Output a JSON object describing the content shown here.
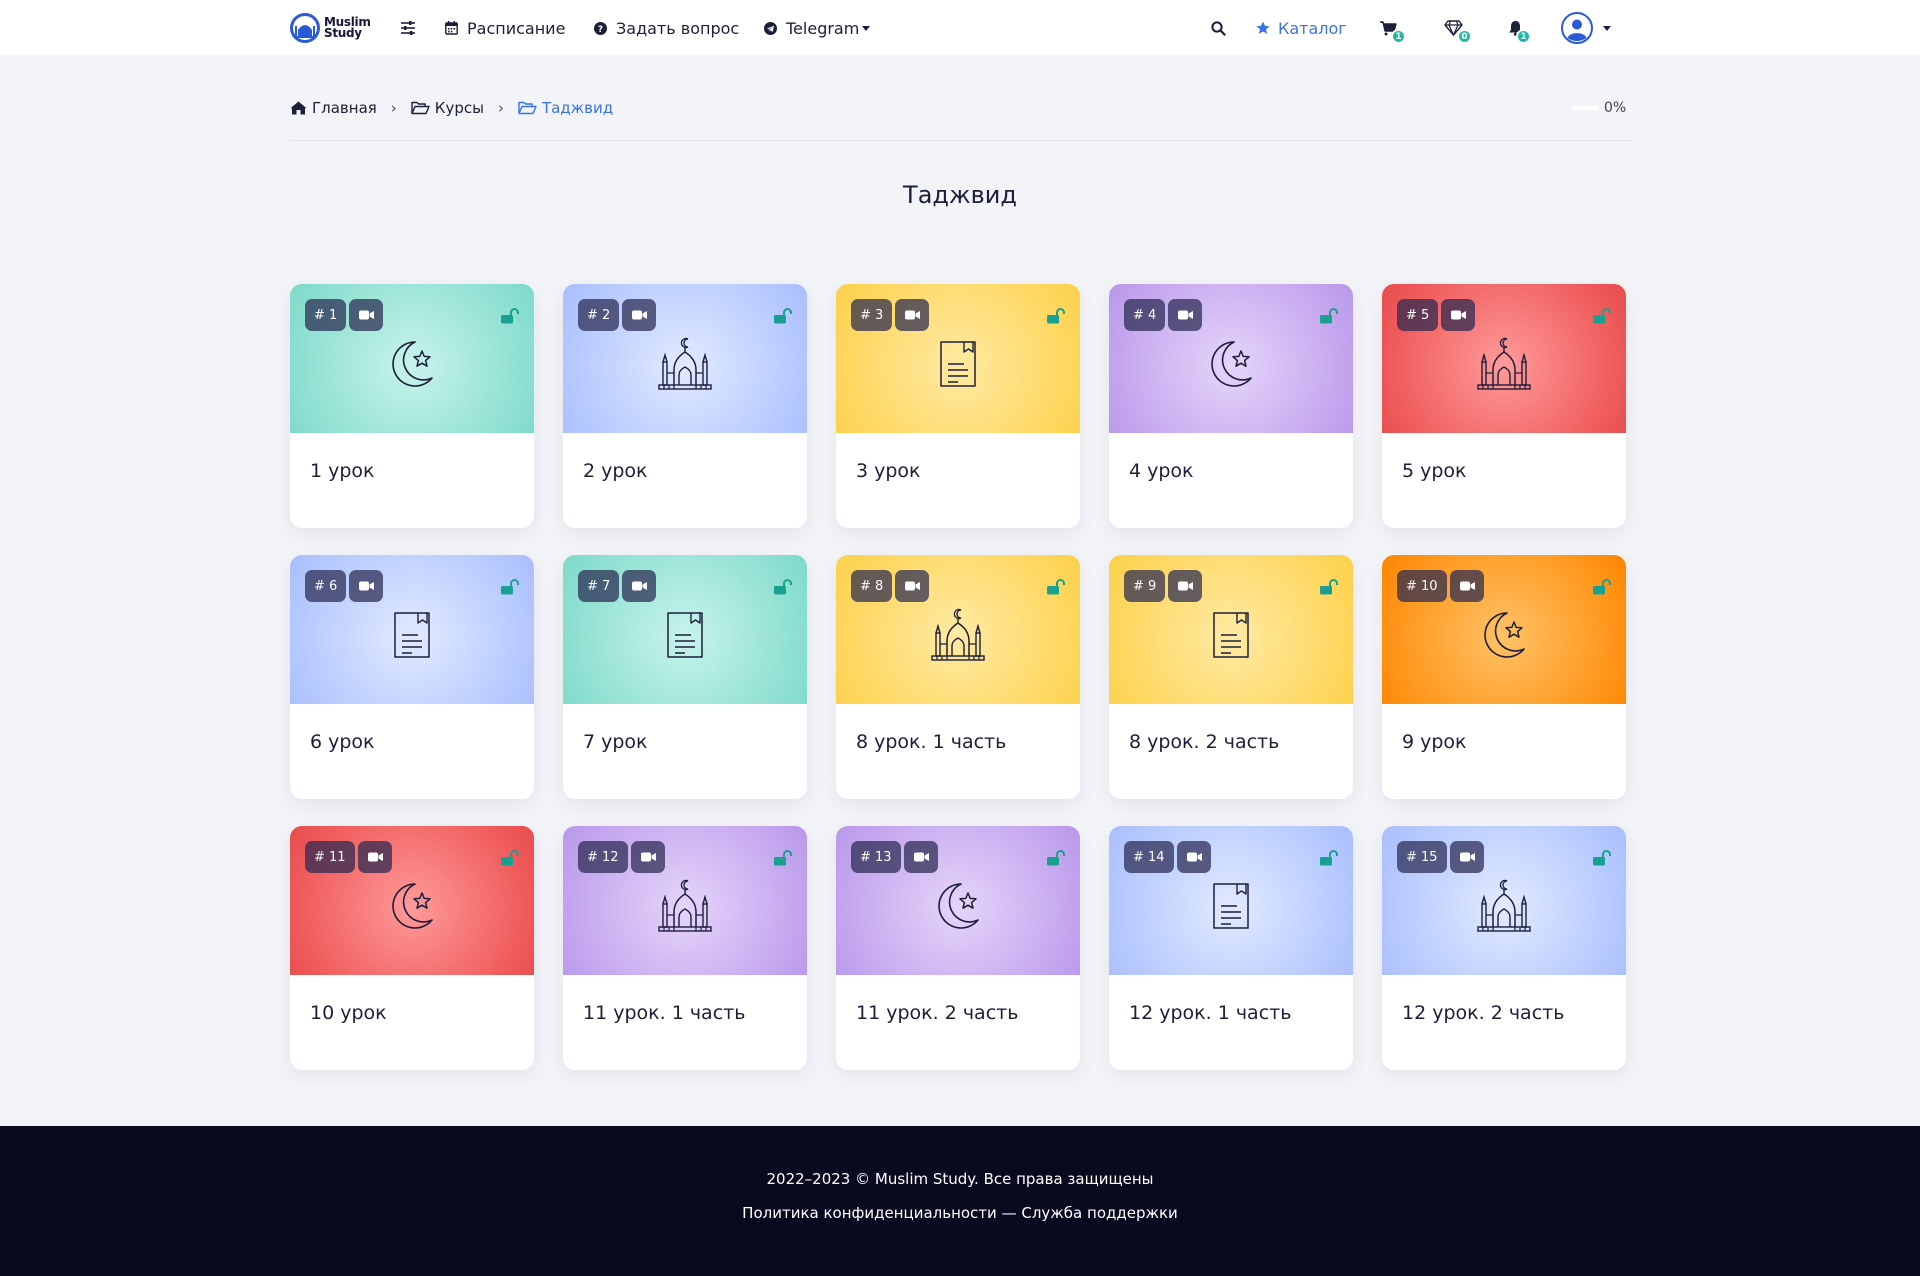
{
  "header": {
    "logo_line1": "Muslim",
    "logo_line2": "Study",
    "nav": {
      "schedule": "Расписание",
      "ask": "Задать вопрос",
      "telegram": "Telegram"
    },
    "catalog": "Каталог",
    "badges": {
      "cart": "1",
      "gems": "0",
      "bell": "1"
    }
  },
  "breadcrumb": {
    "home": "Главная",
    "courses": "Курсы",
    "current": "Таджвид",
    "separator": "›"
  },
  "progress": {
    "value": 0,
    "label": "0%"
  },
  "page_title": "Таджвид",
  "lessons": [
    {
      "num": "# 1",
      "title": "1 урок",
      "theme": "teal",
      "icon": "crescent-star-icon"
    },
    {
      "num": "# 2",
      "title": "2 урок",
      "theme": "blue",
      "icon": "mosque-icon"
    },
    {
      "num": "# 3",
      "title": "3 урок",
      "theme": "yellow",
      "icon": "document-icon"
    },
    {
      "num": "# 4",
      "title": "4 урок",
      "theme": "purple",
      "icon": "crescent-star-icon"
    },
    {
      "num": "# 5",
      "title": "5 урок",
      "theme": "red",
      "icon": "mosque-icon"
    },
    {
      "num": "# 6",
      "title": "6 урок",
      "theme": "blue",
      "icon": "document-icon"
    },
    {
      "num": "# 7",
      "title": "7 урок",
      "theme": "teal",
      "icon": "document-icon"
    },
    {
      "num": "# 8",
      "title": "8 урок. 1 часть",
      "theme": "yellow",
      "icon": "mosque-icon"
    },
    {
      "num": "# 9",
      "title": "8 урок. 2 часть",
      "theme": "yellow",
      "icon": "document-icon"
    },
    {
      "num": "# 10",
      "title": "9 урок",
      "theme": "orange",
      "icon": "crescent-star-icon"
    },
    {
      "num": "# 11",
      "title": "10 урок",
      "theme": "red",
      "icon": "crescent-star-icon"
    },
    {
      "num": "# 12",
      "title": "11 урок. 1 часть",
      "theme": "purple",
      "icon": "mosque-icon"
    },
    {
      "num": "# 13",
      "title": "11 урок. 2 часть",
      "theme": "purple",
      "icon": "crescent-star-icon"
    },
    {
      "num": "# 14",
      "title": "12 урок. 1 часть",
      "theme": "blue",
      "icon": "document-icon"
    },
    {
      "num": "# 15",
      "title": "12 урок. 2 часть",
      "theme": "blue",
      "icon": "mosque-icon"
    }
  ],
  "colors": {
    "accent": "#3b73e4",
    "badge": "#21b8a0",
    "unlock": "#1aa091",
    "footer_bg": "#09091f"
  },
  "footer": {
    "copyright": "2022–2023 © Muslim Study. Все права защищены",
    "privacy": "Политика конфиденциальности",
    "sep": " — ",
    "support": "Служба поддержки"
  }
}
